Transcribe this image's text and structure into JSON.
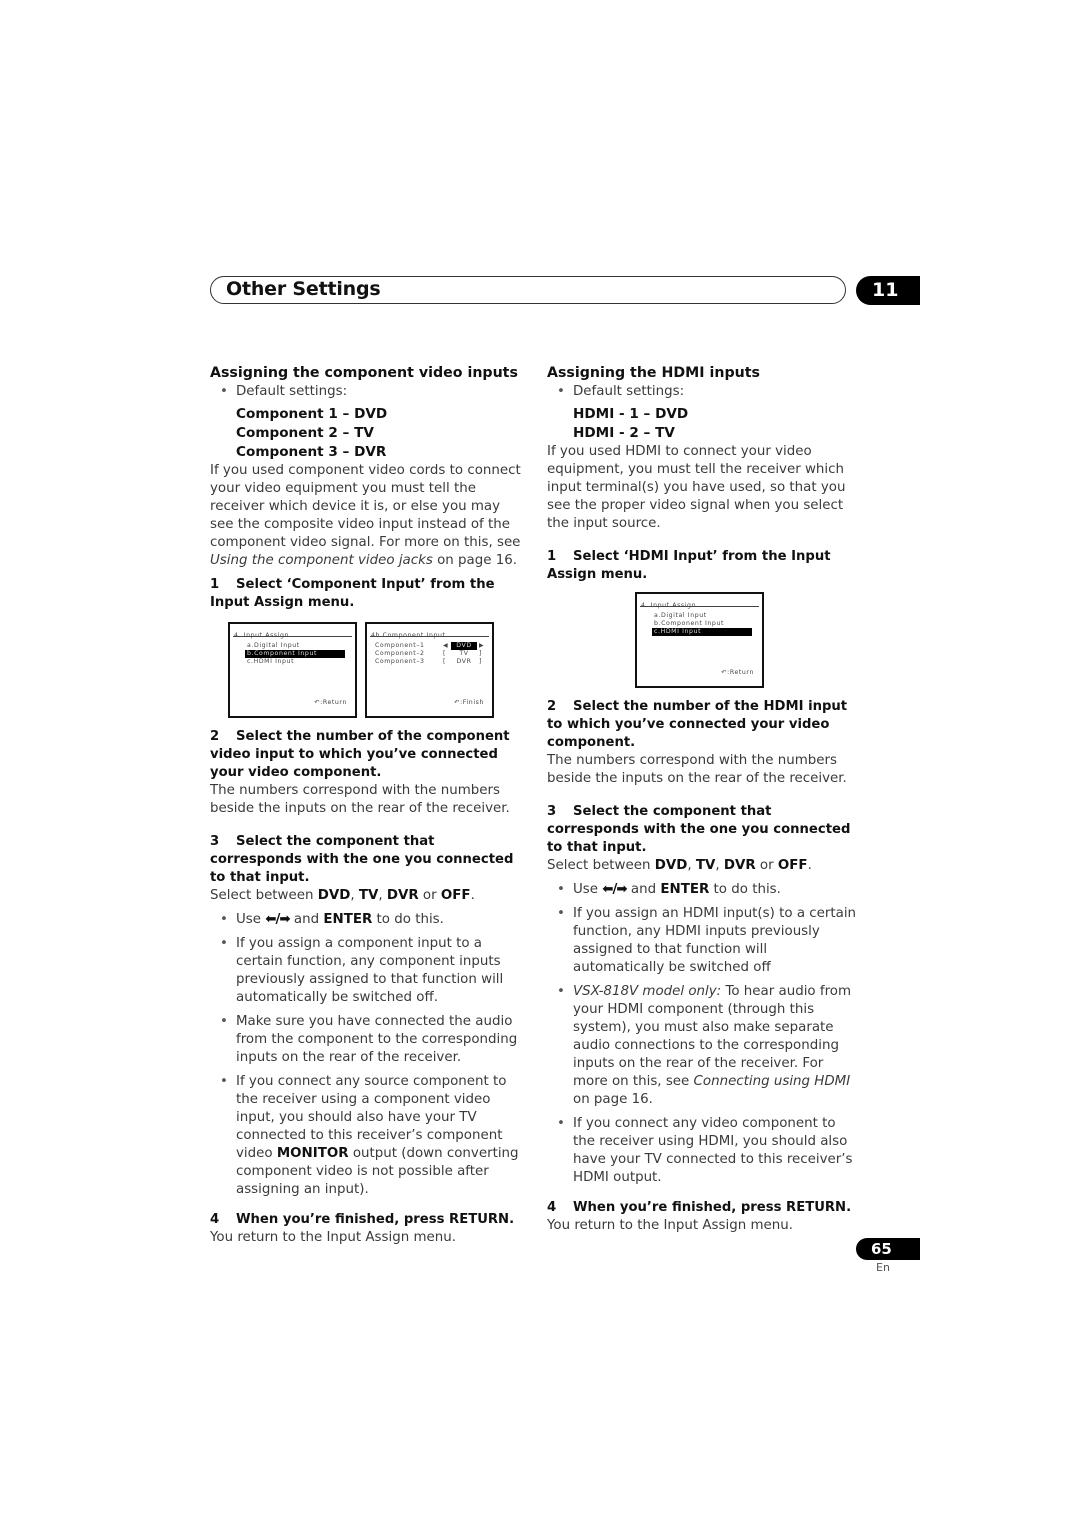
{
  "header": {
    "title": "Other Settings",
    "chapter": "11"
  },
  "left": {
    "heading": "Assigning the component video inputs",
    "default_label": "Default settings:",
    "defaults": [
      "Component 1 – DVD",
      "Component 2 – TV",
      "Component 3 – DVR"
    ],
    "intro": "If you used component video cords to connect your video equipment you must tell the receiver which device it is, or else you may see the composite video input instead of the component video signal. For more on this, see ",
    "intro_link": "Using the component video jacks",
    "intro_tail": " on page 16.",
    "step1_num": "1",
    "step1": "Select ‘Component Input’ from the Input Assign menu.",
    "screen1": {
      "title": "4. Input  Assign",
      "items": [
        "a.Digital  Input",
        "b.Component  Input",
        "c.HDMI  Input"
      ],
      "selected_index": 1,
      "footer": ":Return"
    },
    "screen2": {
      "title": "4b.Component  Input",
      "rows": [
        {
          "label": "Component–1",
          "value": "DVD",
          "selected": true
        },
        {
          "label": "Component–2",
          "value": "TV",
          "selected": false
        },
        {
          "label": "Component–3",
          "value": "DVR",
          "selected": false
        }
      ],
      "footer": ":Finish"
    },
    "step2_num": "2",
    "step2": "Select the number of the component video input to which you’ve connected your video component.",
    "step2_text": "The numbers correspond with the numbers beside the inputs on the rear of the receiver.",
    "step3_num": "3",
    "step3": "Select the component that corresponds with the one you connected to that input.",
    "step3_text_pre": "Select between ",
    "opt_dvd": "DVD",
    "opt_tv": "TV",
    "opt_dvr": "DVR",
    "opt_or": " or ",
    "opt_off": "OFF",
    "bullet_use_pre": "Use ",
    "bullet_use_arrows": "⬅/➡",
    "bullet_use_mid": " and ",
    "bullet_use_enter": "ENTER",
    "bullet_use_post": " to do this.",
    "bullet2": "If you assign a component input to a certain function, any component inputs previously assigned to that function will automatically be switched off.",
    "bullet3": "Make sure you have connected the audio from the component to the corresponding inputs on the rear of the receiver.",
    "bullet4_pre": "If you connect any source component to the receiver using a component video input, you should also have your TV connected to this receiver’s component video ",
    "bullet4_bold": "MONITOR",
    "bullet4_post": " output (down converting component video is not possible after assigning an input).",
    "step4_num": "4",
    "step4": "When you’re finished, press RETURN.",
    "step4_text": "You return to the Input Assign menu."
  },
  "right": {
    "heading": "Assigning the HDMI inputs",
    "default_label": "Default settings:",
    "defaults": [
      "HDMI - 1 – DVD",
      "HDMI - 2 – TV"
    ],
    "intro": "If you used HDMI to connect your video equipment, you must tell the receiver which input terminal(s) you have used, so that you see the proper video signal when you select the input source.",
    "step1_num": "1",
    "step1": "Select ‘HDMI Input’ from the Input Assign menu.",
    "screen1": {
      "title": "4. Input  Assign",
      "items": [
        "a.Digital  Input",
        "b.Component  Input",
        "c.HDMI  Input"
      ],
      "selected_index": 2,
      "footer": ":Return"
    },
    "step2_num": "2",
    "step2": "Select the number of the HDMI input to which you’ve connected your video component.",
    "step2_text": "The numbers correspond with the numbers beside the inputs on the rear of the receiver.",
    "step3_num": "3",
    "step3": "Select the component that corresponds with the one you connected to that input.",
    "step3_text_pre": "Select between ",
    "opt_dvd": "DVD",
    "opt_tv": "TV",
    "opt_dvr": "DVR",
    "opt_or": " or ",
    "opt_off": "OFF",
    "bullet_use_pre": "Use ",
    "bullet_use_arrows": "⬅/➡",
    "bullet_use_mid": " and ",
    "bullet_use_enter": "ENTER",
    "bullet_use_post": " to do this.",
    "bullet2": "If you assign an HDMI input(s) to a certain function, any HDMI inputs previously assigned to that function will automatically be switched off",
    "bullet3_italic": "VSX-818V model only:",
    "bullet3_pre": " To hear audio from your HDMI component (through this system), you must also make separate audio connections to the corresponding inputs on the rear of the receiver. For more on this, see ",
    "bullet3_link": "Connecting using HDMI",
    "bullet3_post": " on page 16.",
    "bullet4": "If you connect any video component to the receiver using HDMI, you should also have your TV connected to this receiver’s HDMI output.",
    "step4_num": "4",
    "step4": "When you’re finished, press RETURN.",
    "step4_text": "You return to the Input Assign menu."
  },
  "footer": {
    "page_number": "65",
    "language": "En"
  },
  "icons": {
    "return_icon": "↶"
  }
}
